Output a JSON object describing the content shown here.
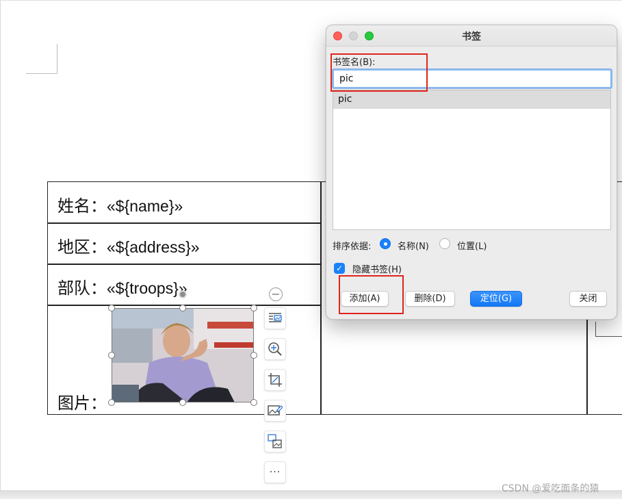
{
  "document": {
    "rows": [
      {
        "label": "姓名：",
        "field": "«${name}»"
      },
      {
        "label": "地区：",
        "field": "«${address}»"
      },
      {
        "label": "部队：",
        "field": "«${troops}»"
      },
      {
        "label": "图片："
      }
    ],
    "picture_caption": "image placeholder photo"
  },
  "picture_toolbar": {
    "collapse_glyph": "−",
    "buttons": [
      {
        "name": "text-wrap-icon"
      },
      {
        "name": "zoom-in-icon"
      },
      {
        "name": "crop-icon"
      },
      {
        "name": "change-picture-icon"
      },
      {
        "name": "picture-effects-icon"
      },
      {
        "name": "more-icon",
        "glyph": "···"
      }
    ]
  },
  "dialog": {
    "title": "书签",
    "name_label": "书签名(B):",
    "name_value": "pic",
    "bookmarks": [
      "pic"
    ],
    "sort_label": "排序依据:",
    "sort_options": [
      {
        "label": "名称(N)",
        "selected": true
      },
      {
        "label": "位置(L)",
        "selected": false
      }
    ],
    "hide_label": "隐藏书签(H)",
    "hide_checked": true,
    "buttons": {
      "add": "添加(A)",
      "delete": "删除(D)",
      "goto": "定位(G)",
      "close": "关闭"
    },
    "colors": {
      "accent": "#1a82fb",
      "close_dot": "#fe5f57",
      "min_dot": "#d4d4d4",
      "max_dot": "#28c840",
      "highlight": "#e0241c"
    }
  },
  "watermark": "CSDN @爱吃面条的猿"
}
